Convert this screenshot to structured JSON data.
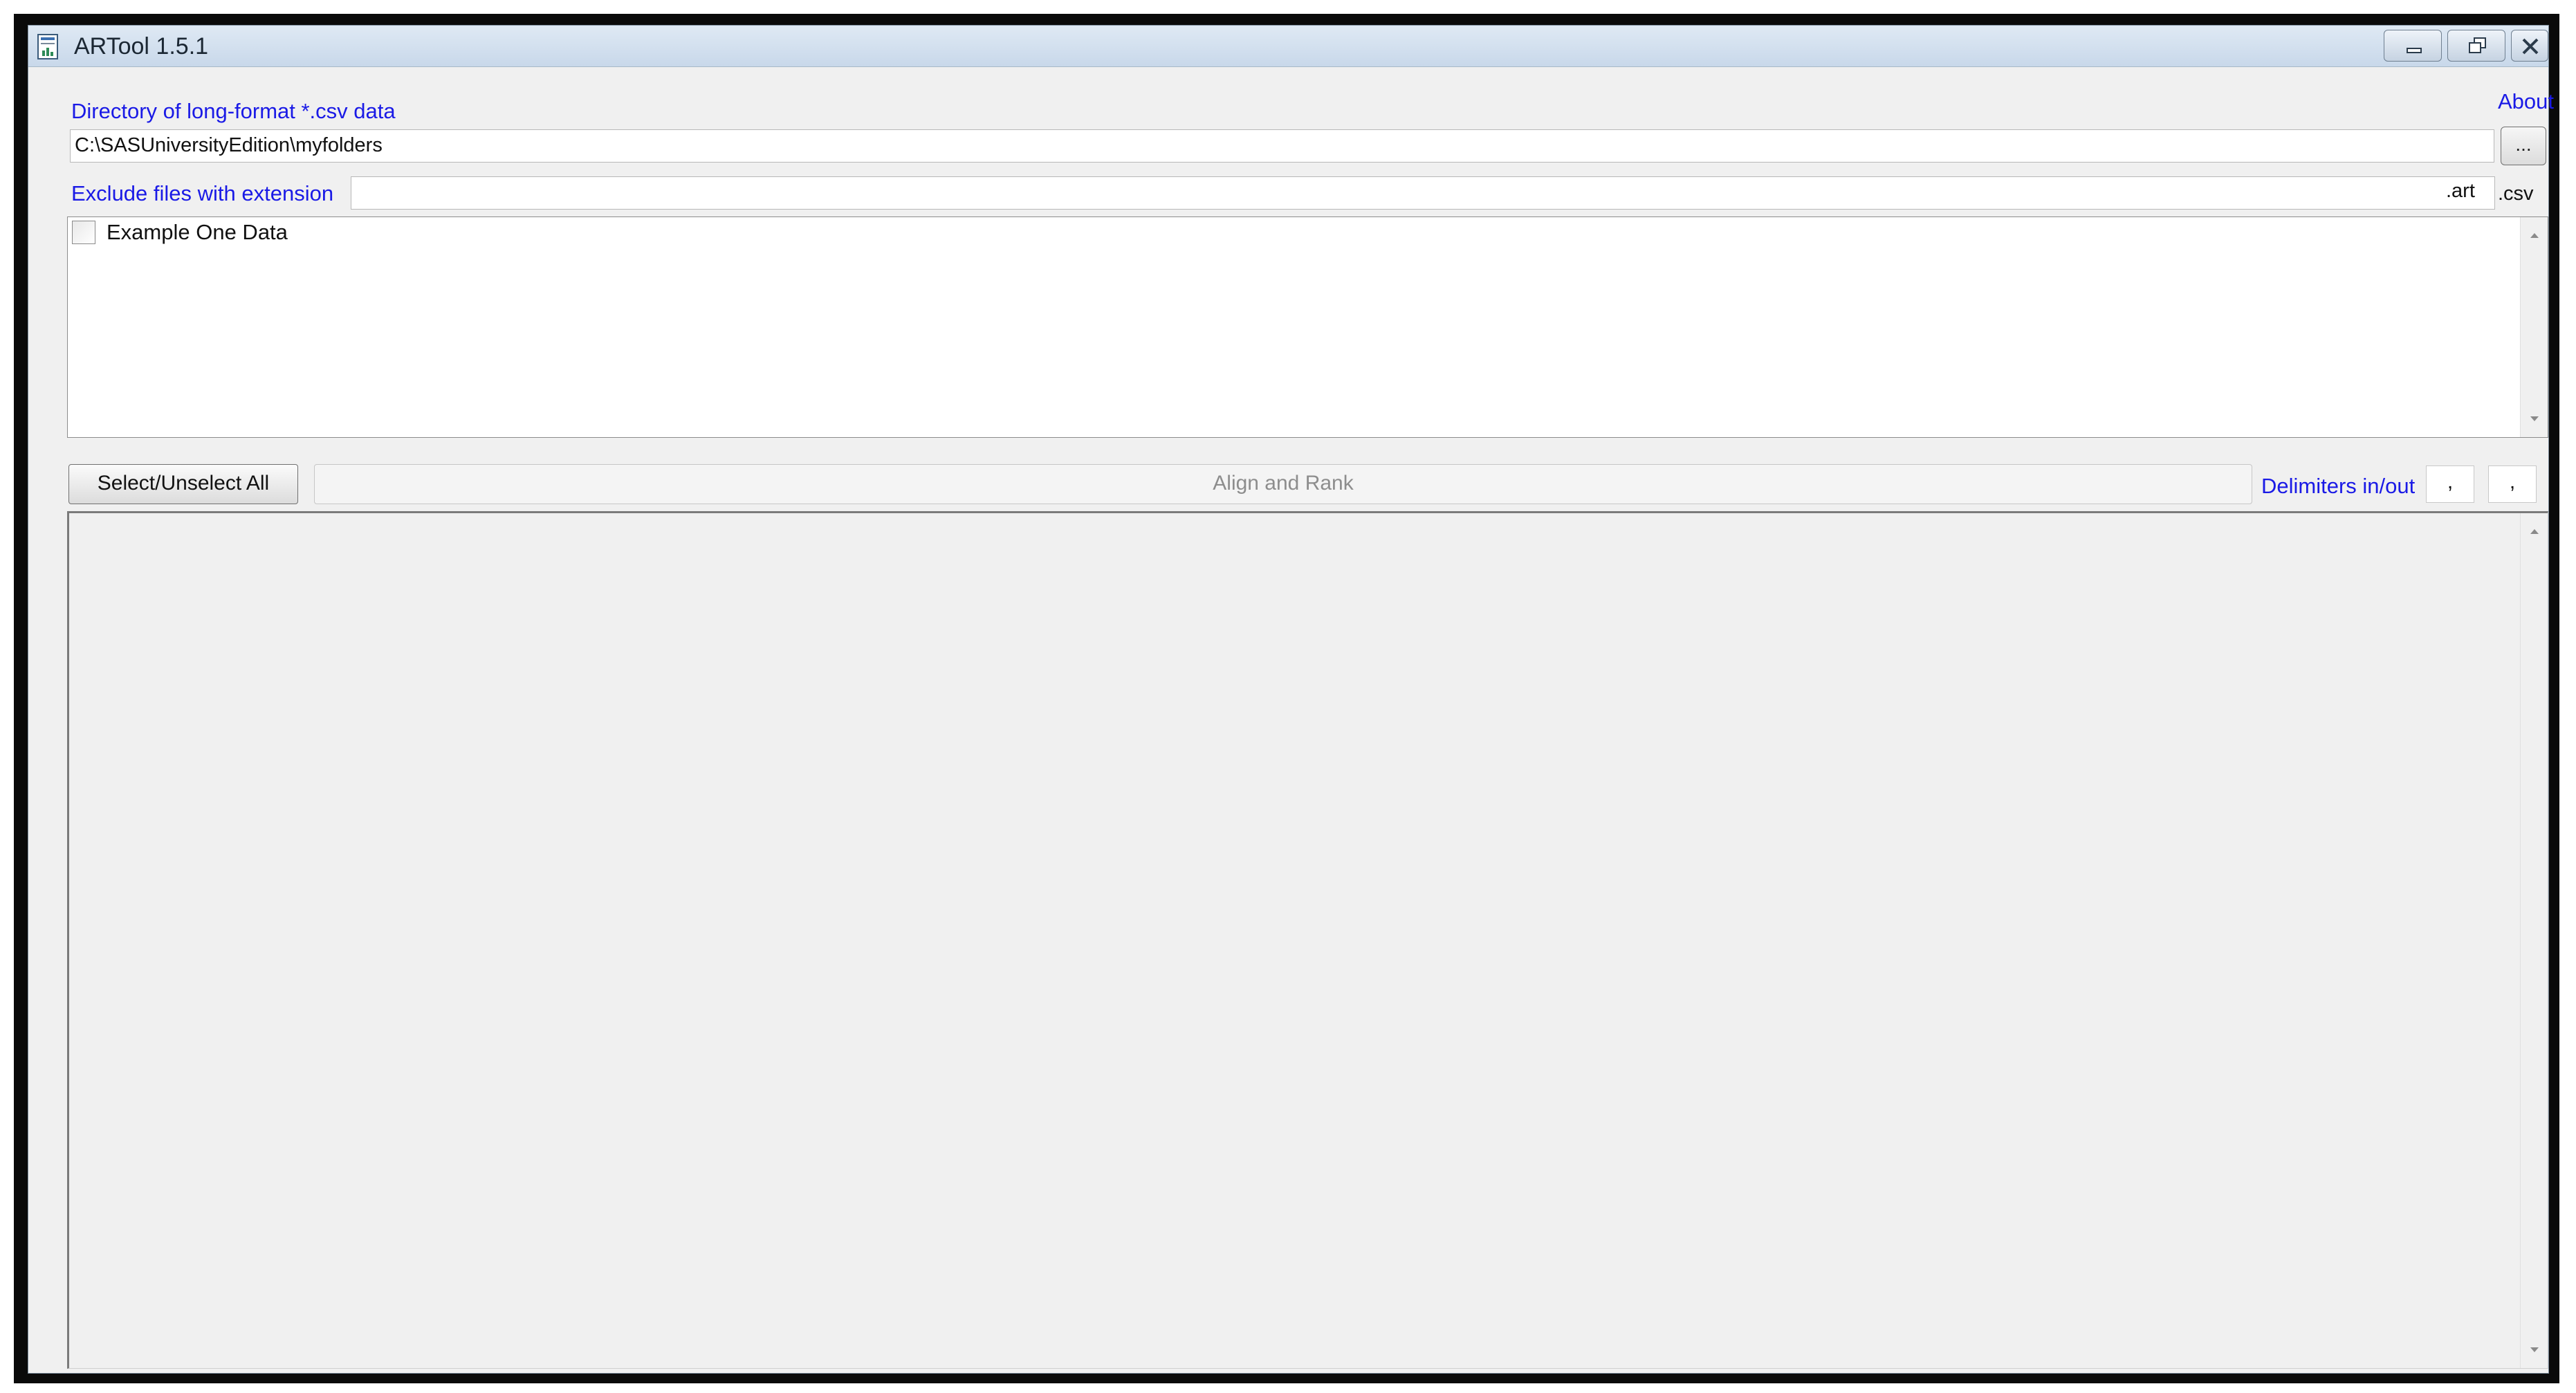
{
  "window": {
    "title": "ARTool 1.5.1",
    "controls": [
      "minimize",
      "restore",
      "close"
    ]
  },
  "about_link": "About",
  "directory": {
    "label": "Directory of long-format *.csv data",
    "value": "C:\\SASUniversityEdition\\myfolders",
    "browse_label": "..."
  },
  "exclude": {
    "label": "Exclude files with extension",
    "value": "",
    "extension_suffix": ".art",
    "csv_suffix": ".csv"
  },
  "file_list": {
    "items": [
      {
        "label": "Example One Data",
        "checked": false
      }
    ]
  },
  "actions": {
    "select_all_label": "Select/Unselect All",
    "align_rank_label": "Align and Rank",
    "align_rank_enabled": false
  },
  "delimiters": {
    "label": "Delimiters in/out",
    "in_value": ",",
    "out_value": ","
  },
  "output": {
    "text": ""
  },
  "colors": {
    "link_blue": "#1a1ae6",
    "window_bg": "#f0f0f0",
    "titlebar": "#c8d8ea"
  },
  "icons": [
    "app-icon",
    "minimize-icon",
    "restore-icon",
    "close-icon",
    "scroll-up-icon",
    "scroll-down-icon"
  ]
}
